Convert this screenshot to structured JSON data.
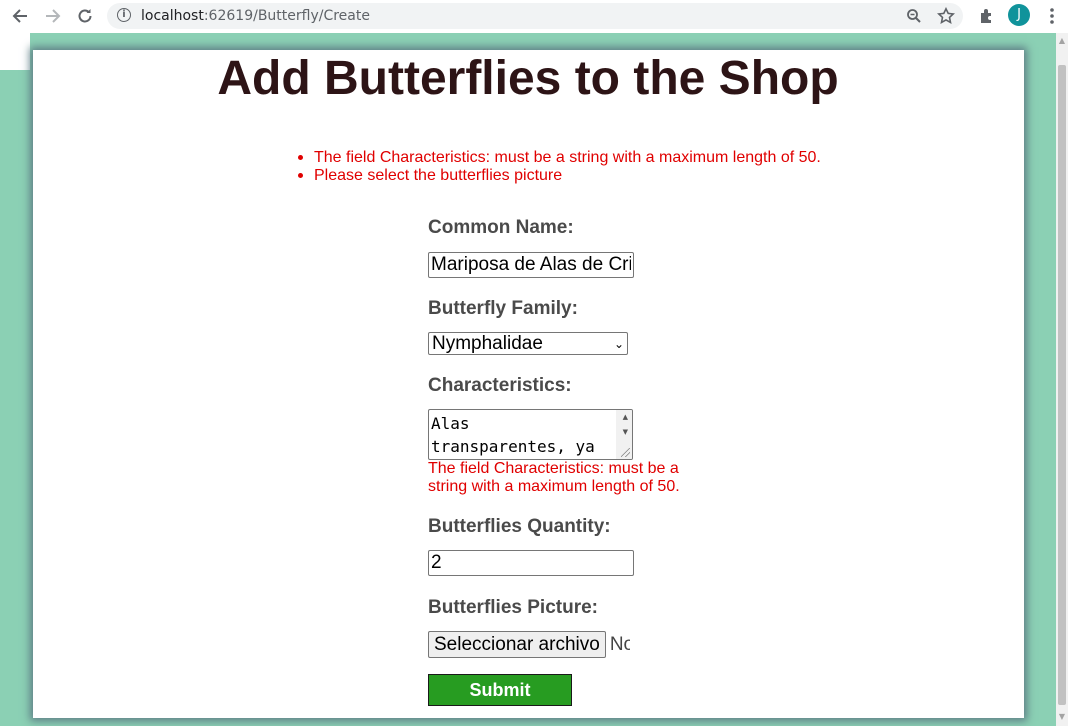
{
  "browser": {
    "url_host": "localhost",
    "url_rest": ":62619/Butterfly/Create",
    "avatar_letter": "J"
  },
  "page": {
    "title": "Add Butterflies to the Shop",
    "validation_summary": [
      "The field Characteristics: must be a string with a maximum length of 50.",
      "Please select the butterflies picture"
    ],
    "form": {
      "common_name_label": "Common Name:",
      "common_name_value": "Mariposa de Alas de Cristal",
      "family_label": "Butterfly Family:",
      "family_value": "Nymphalidae",
      "characteristics_label": "Characteristics:",
      "characteristics_value": "Alas\ntransparentes, ya",
      "characteristics_error": "The field Characteristics: must be a string with a maximum length of 50.",
      "quantity_label": "Butterflies Quantity:",
      "quantity_value": "2",
      "picture_label": "Butterflies Picture:",
      "file_button_label": "Seleccionar archivo",
      "file_status": "No se ha seleccionado ningún archivo",
      "submit_label": "Submit"
    }
  },
  "colors": {
    "page_background": "#8bd0b4",
    "title": "#2d1416",
    "error": "#e00000",
    "submit": "#279c21"
  }
}
